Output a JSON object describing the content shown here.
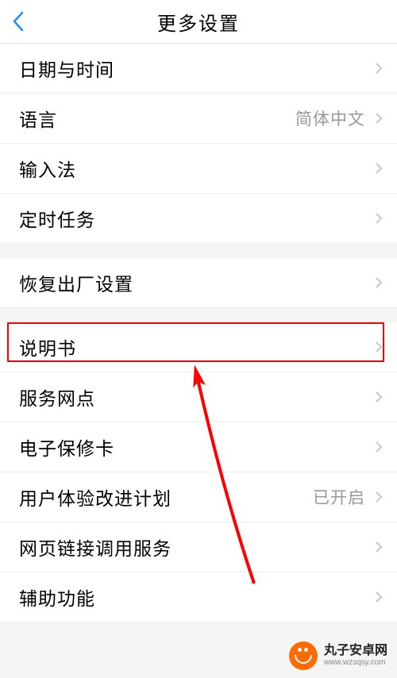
{
  "header": {
    "title": "更多设置"
  },
  "items": {
    "datetime": {
      "label": "日期与时间",
      "value": ""
    },
    "language": {
      "label": "语言",
      "value": "简体中文"
    },
    "ime": {
      "label": "输入法",
      "value": ""
    },
    "scheduled": {
      "label": "定时任务",
      "value": ""
    },
    "factory_reset": {
      "label": "恢复出厂设置",
      "value": ""
    },
    "manual": {
      "label": "说明书",
      "value": ""
    },
    "service_points": {
      "label": "服务网点",
      "value": ""
    },
    "warranty": {
      "label": "电子保修卡",
      "value": ""
    },
    "uip": {
      "label": "用户体验改进计划",
      "value": "已开启"
    },
    "weblink": {
      "label": "网页链接调用服务",
      "value": ""
    },
    "accessibility": {
      "label": "辅助功能",
      "value": ""
    }
  },
  "annotation": {
    "highlight_target": "manual"
  },
  "watermark": {
    "title": "丸子安卓网",
    "url": "www.wzsqsy.com"
  }
}
